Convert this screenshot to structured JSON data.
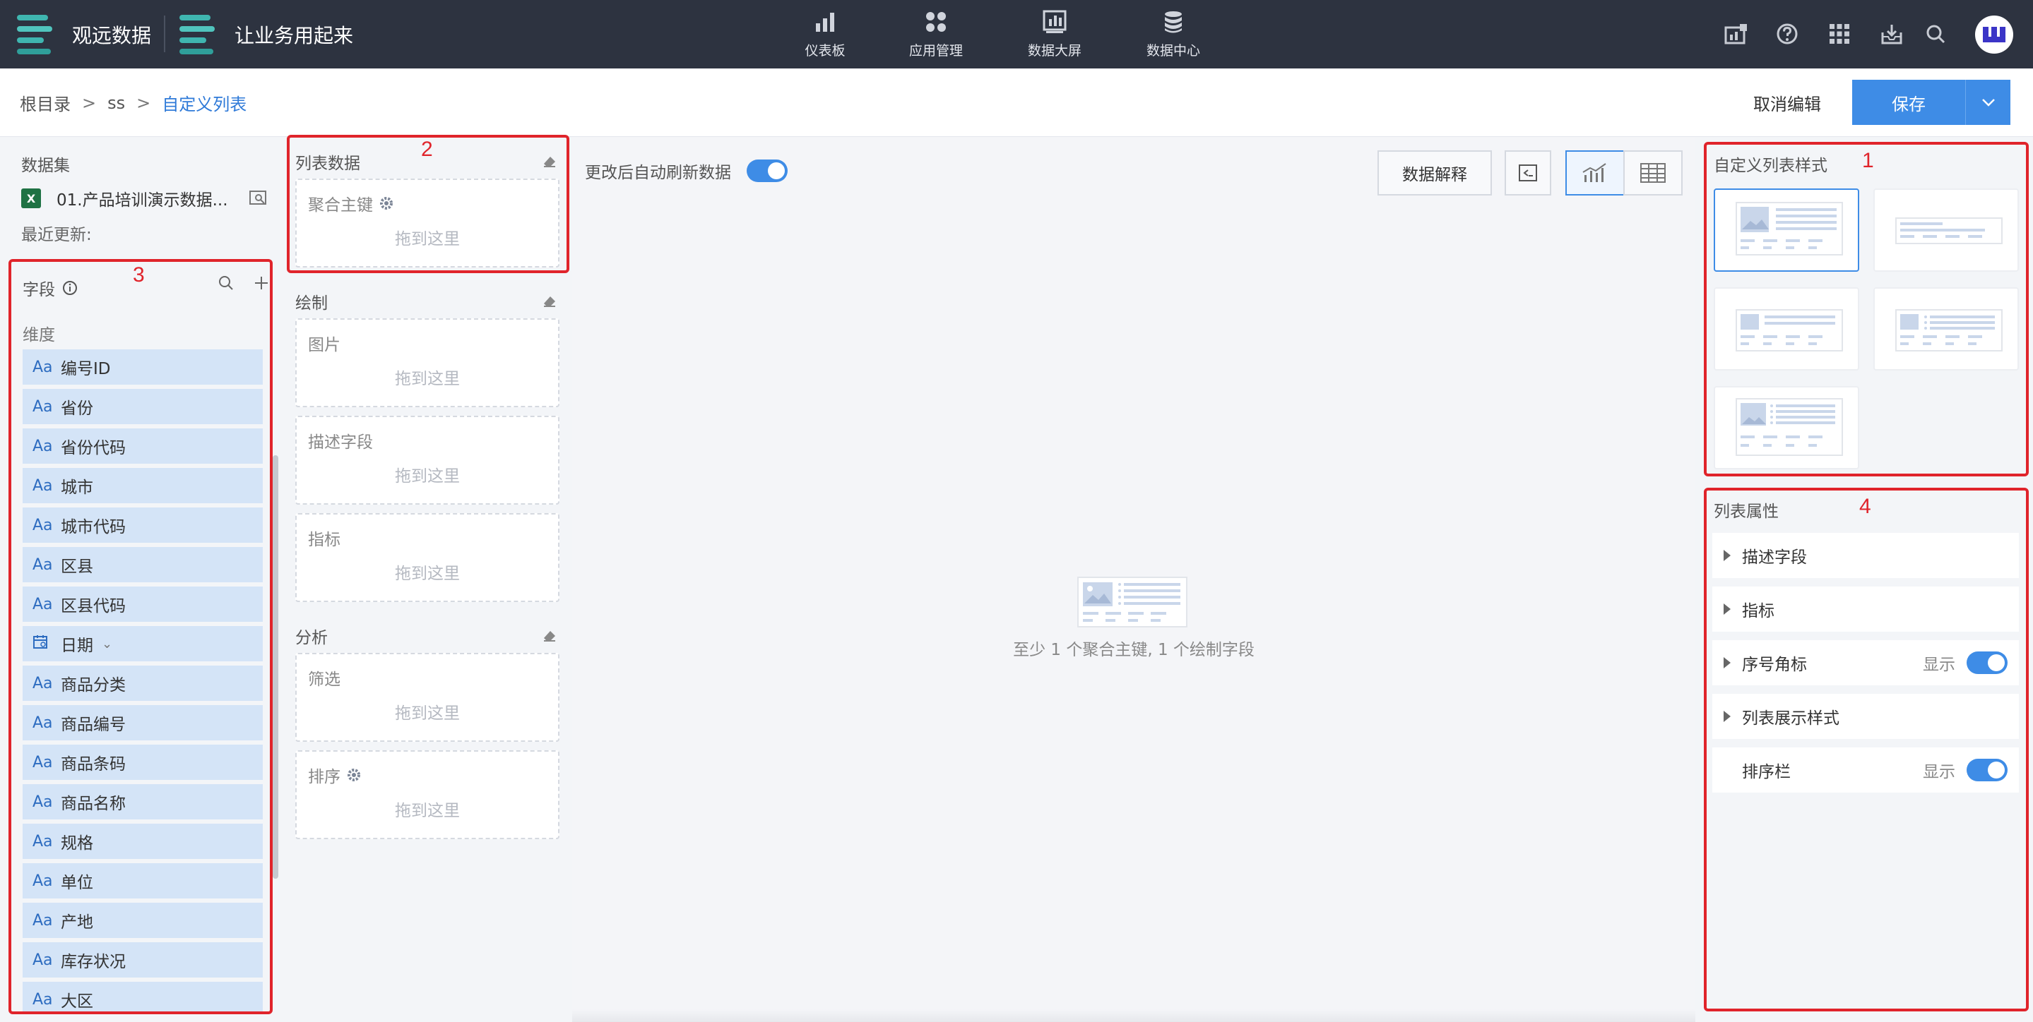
{
  "topbar": {
    "brand1": "观远数据",
    "brand2": "让业务用起来",
    "nav": [
      {
        "label": "仪表板",
        "icon": "bar-chart-icon"
      },
      {
        "label": "应用管理",
        "icon": "apps-grid-icon"
      },
      {
        "label": "数据大屏",
        "icon": "screen-icon"
      },
      {
        "label": "数据中心",
        "icon": "database-icon"
      }
    ]
  },
  "breadcrumb": {
    "root": "根目录",
    "sep": ">",
    "mid": "ss",
    "current": "自定义列表"
  },
  "actions": {
    "cancel": "取消编辑",
    "save": "保存"
  },
  "dataset": {
    "title": "数据集",
    "name": "01.产品培训演示数据...",
    "updated": "最近更新:",
    "file_badge": "X"
  },
  "fields": {
    "title": "字段",
    "dimension_title": "维度",
    "type_label": "Aa",
    "items": [
      {
        "name": "编号ID",
        "type": "text"
      },
      {
        "name": "省份",
        "type": "text"
      },
      {
        "name": "省份代码",
        "type": "text"
      },
      {
        "name": "城市",
        "type": "text"
      },
      {
        "name": "城市代码",
        "type": "text"
      },
      {
        "name": "区县",
        "type": "text"
      },
      {
        "name": "区县代码",
        "type": "text"
      },
      {
        "name": "日期",
        "type": "date"
      },
      {
        "name": "商品分类",
        "type": "text"
      },
      {
        "name": "商品编号",
        "type": "text"
      },
      {
        "name": "商品条码",
        "type": "text"
      },
      {
        "name": "商品名称",
        "type": "text"
      },
      {
        "name": "规格",
        "type": "text"
      },
      {
        "name": "单位",
        "type": "text"
      },
      {
        "name": "产地",
        "type": "text"
      },
      {
        "name": "库存状况",
        "type": "text"
      },
      {
        "name": "大区",
        "type": "text"
      }
    ]
  },
  "config": {
    "list_data": {
      "title": "列表数据",
      "slots": [
        {
          "label": "聚合主键"
        }
      ]
    },
    "draw": {
      "title": "绘制",
      "slots": [
        {
          "label": "图片"
        },
        {
          "label": "描述字段"
        },
        {
          "label": "指标"
        }
      ]
    },
    "analysis": {
      "title": "分析",
      "slots": [
        {
          "label": "筛选"
        },
        {
          "label": "排序"
        }
      ]
    },
    "placeholder": "拖到这里"
  },
  "center": {
    "auto_refresh": "更改后自动刷新数据",
    "auto_refresh_on": true,
    "explain": "数据解释",
    "empty_message": "至少 1 个聚合主键, 1 个绘制字段"
  },
  "right": {
    "style_title": "自定义列表样式",
    "selected_style": 0,
    "prop_title": "列表属性",
    "props": [
      {
        "label": "描述字段",
        "expandable": true
      },
      {
        "label": "指标",
        "expandable": true
      },
      {
        "label": "序号角标",
        "expandable": true,
        "toggle_label": "显示",
        "on": true
      },
      {
        "label": "列表展示样式",
        "expandable": true
      },
      {
        "label": "排序栏",
        "expandable": false,
        "toggle_label": "显示",
        "on": true
      }
    ]
  },
  "annotations": [
    "1",
    "2",
    "3",
    "4"
  ],
  "colors": {
    "accent": "#3e8ce6",
    "topbar": "#2d3340",
    "annotation": "#e0242b",
    "field_bg": "#d4e4f7"
  }
}
